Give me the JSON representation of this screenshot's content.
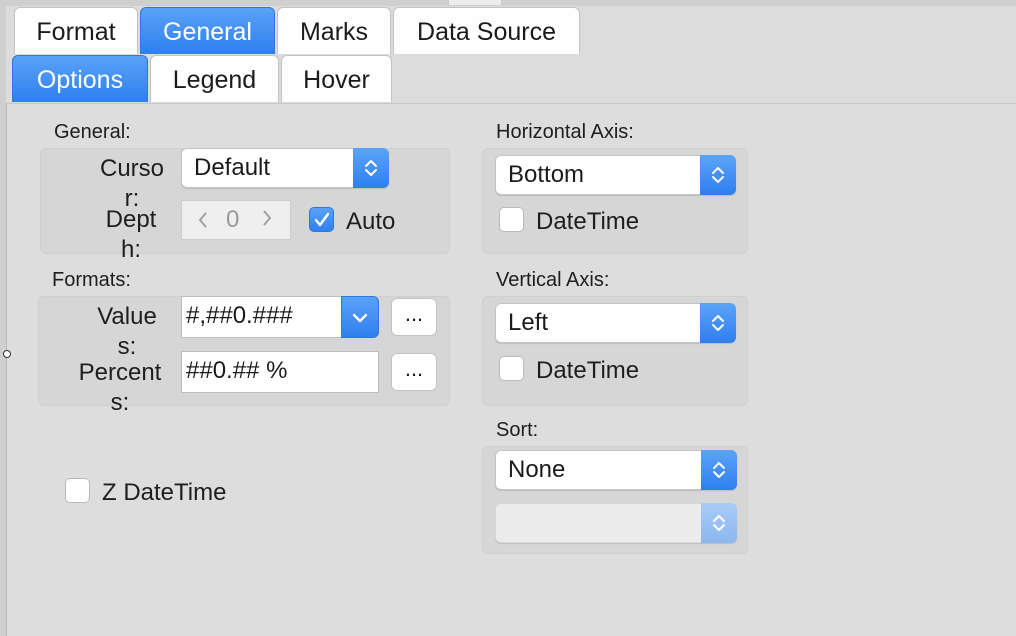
{
  "tabs_top": [
    {
      "label": "Format",
      "active": false
    },
    {
      "label": "General",
      "active": true
    },
    {
      "label": "Marks",
      "active": false
    },
    {
      "label": "Data Source",
      "active": false
    }
  ],
  "tabs_sub": [
    {
      "label": "Options",
      "active": true
    },
    {
      "label": "Legend",
      "active": false
    },
    {
      "label": "Hover",
      "active": false
    }
  ],
  "general": {
    "title": "General:",
    "cursor_label": "Cursor:",
    "cursor_value": "Default",
    "depth_label": "Depth:",
    "depth_value": "0",
    "auto_label": "Auto",
    "auto_checked": true
  },
  "formats": {
    "title": "Formats:",
    "values_label": "Values:",
    "values_value": "#,##0.###",
    "percents_label": "Percents:",
    "percents_value": "##0.## %",
    "ellipsis": "..."
  },
  "z_datetime": {
    "label": "Z DateTime",
    "checked": false
  },
  "horizontal_axis": {
    "title": "Horizontal Axis:",
    "value": "Bottom",
    "datetime_label": "DateTime",
    "datetime_checked": false
  },
  "vertical_axis": {
    "title": "Vertical Axis:",
    "value": "Left",
    "datetime_label": "DateTime",
    "datetime_checked": false
  },
  "sort": {
    "title": "Sort:",
    "value": "None",
    "secondary_value": ""
  },
  "colors": {
    "accent": "#2f80ef",
    "panel": "#dddddd",
    "group": "#d6d6d6"
  }
}
